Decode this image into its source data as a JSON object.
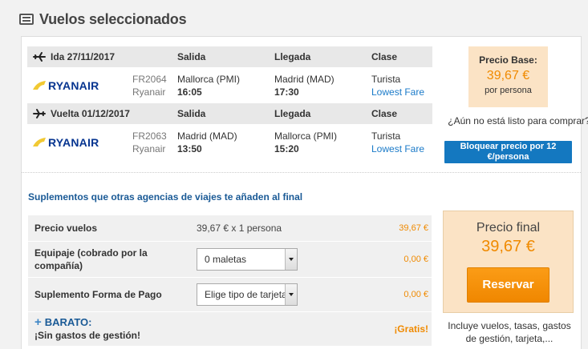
{
  "header": {
    "title": "Vuelos seleccionados",
    "icon": "list-icon"
  },
  "flights": [
    {
      "direction": "Ida 27/11/2017",
      "col_salida": "Salida",
      "col_llegada": "Llegada",
      "col_clase": "Clase",
      "airline_logo": "RYANAIR",
      "flight_number": "FR2064",
      "airline_name": "Ryanair",
      "depart_airport": "Mallorca (PMI)",
      "depart_time": "16:05",
      "arrive_airport": "Madrid (MAD)",
      "arrive_time": "17:30",
      "class_name": "Turista",
      "fare": "Lowest Fare"
    },
    {
      "direction": "Vuelta 01/12/2017",
      "col_salida": "Salida",
      "col_llegada": "Llegada",
      "col_clase": "Clase",
      "airline_logo": "RYANAIR",
      "flight_number": "FR2063",
      "airline_name": "Ryanair",
      "depart_airport": "Madrid (MAD)",
      "depart_time": "13:50",
      "arrive_airport": "Mallorca (PMI)",
      "arrive_time": "15:20",
      "class_name": "Turista",
      "fare": "Lowest Fare"
    }
  ],
  "price_base": {
    "label": "Precio Base:",
    "amount": "39,67 €",
    "per": "por persona"
  },
  "block_price": {
    "question": "¿Aún no está listo para comprar?",
    "button": "Bloquear precio por 12 €/persona"
  },
  "supplements": {
    "title": "Suplementos que otras agencias de viajes te añaden al final",
    "rows": [
      {
        "label": "Precio vuelos",
        "detail": "39,67 € x 1 persona",
        "amount": "39,67 €"
      },
      {
        "label": "Equipaje (cobrado por la compañía)",
        "select": "0 maletas",
        "amount": "0,00 €"
      },
      {
        "label": "Suplemento Forma de Pago",
        "select": "Elige tipo de tarjeta",
        "amount": "0,00 €"
      }
    ],
    "barato_title": "BARATO:",
    "barato_sub": "¡Sin gastos de gestión!",
    "barato_amount": "¡Gratis!"
  },
  "price_final": {
    "label": "Precio final",
    "amount": "39,67 €",
    "button": "Reservar"
  },
  "includes": "Incluye vuelos, tasas, gastos de gestión, tarjeta,...",
  "colors": {
    "accent_orange": "#f08a00",
    "link_blue": "#1a7ac8",
    "brand_navy": "#073590",
    "peach": "#fbe3c5"
  }
}
